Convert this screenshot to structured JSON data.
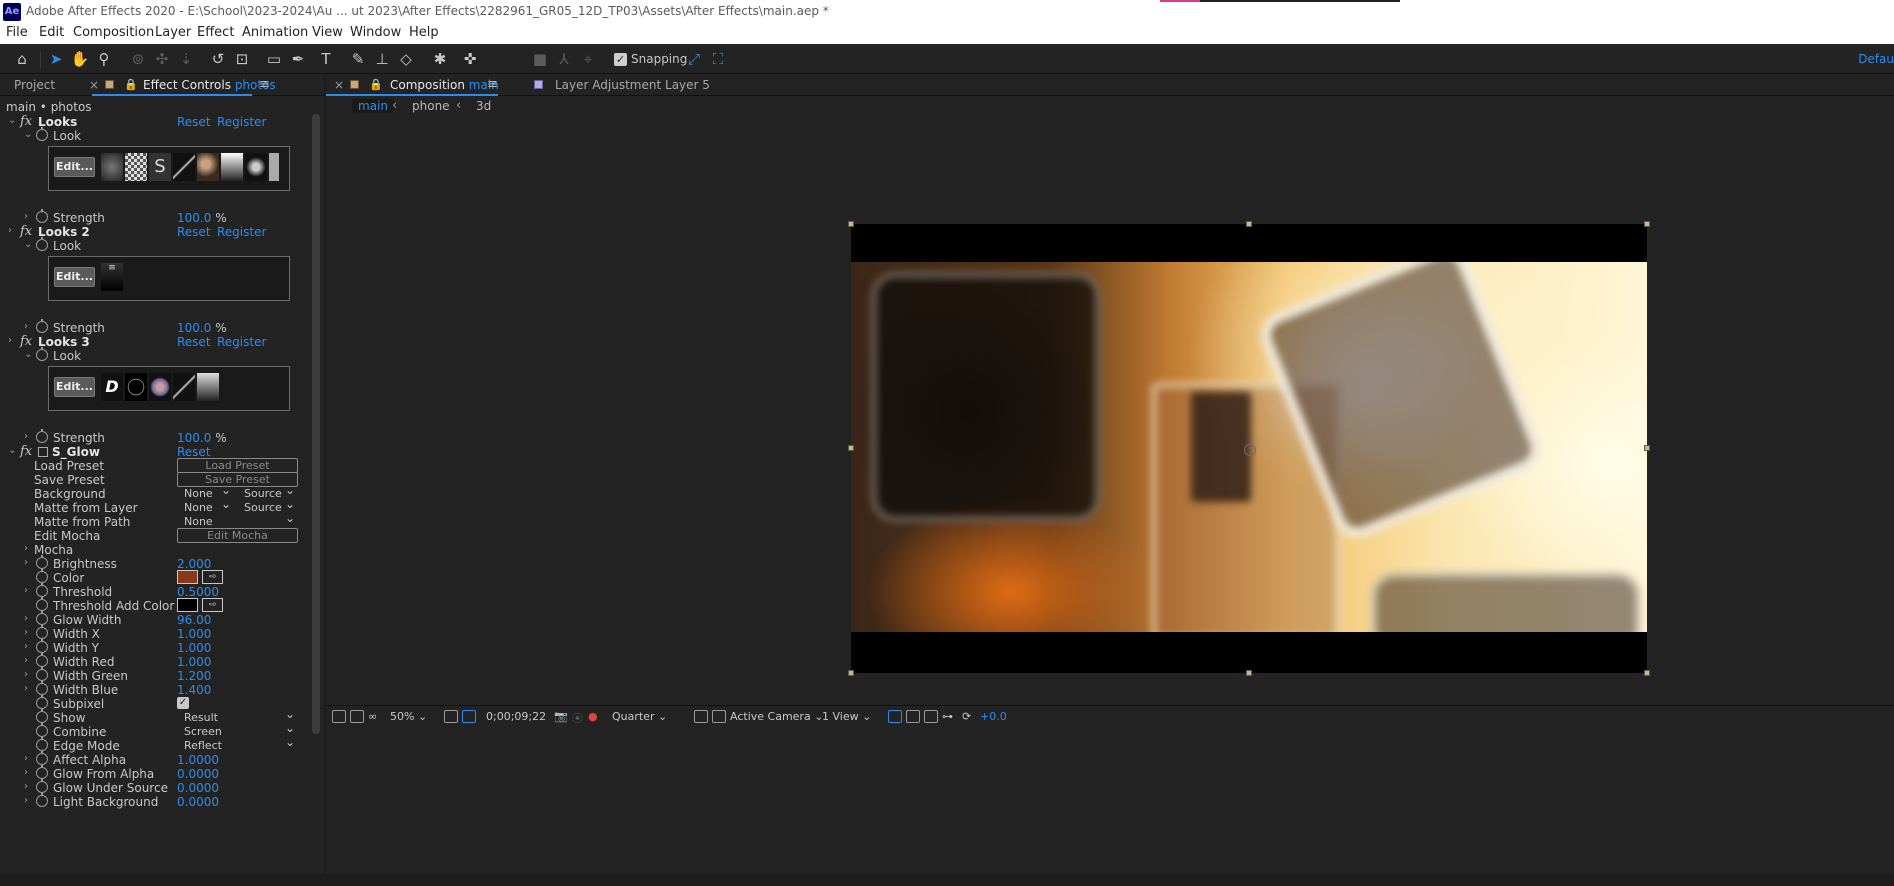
{
  "window": {
    "title": "Adobe After Effects 2020 - E:\\School\\2023-2024\\Au ... ut 2023\\After Effects\\2282961_GR05_12D_TP03\\Assets\\After Effects\\main.aep *",
    "app_badge": "Ae"
  },
  "menu": [
    "File",
    "Edit",
    "Composition",
    "Layer",
    "Effect",
    "Animation",
    "View",
    "Window",
    "Help"
  ],
  "toolbar": {
    "snapping_label": "Snapping",
    "snapping_checked": true,
    "workspace": "Defau"
  },
  "left_panel": {
    "tabs": {
      "project": "Project",
      "effect_controls_prefix": "Effect Controls",
      "effect_controls_layer": "photos"
    },
    "breadcrumb": "main • photos",
    "effects": {
      "looks1": {
        "name": "Looks",
        "reset": "Reset",
        "register": "Register",
        "look_label": "Look",
        "edit": "Edit...",
        "strength_label": "Strength",
        "strength_value": "100.0",
        "strength_unit": "%"
      },
      "looks2": {
        "name": "Looks 2",
        "reset": "Reset",
        "register": "Register",
        "look_label": "Look",
        "edit": "Edit...",
        "strength_label": "Strength",
        "strength_value": "100.0",
        "strength_unit": "%"
      },
      "looks3": {
        "name": "Looks 3",
        "reset": "Reset",
        "register": "Register",
        "look_label": "Look",
        "edit": "Edit...",
        "strength_label": "Strength",
        "strength_value": "100.0",
        "strength_unit": "%"
      },
      "sglow": {
        "name": "S_Glow",
        "reset": "Reset",
        "load_preset_label": "Load Preset",
        "load_preset_btn": "Load Preset",
        "save_preset_label": "Save Preset",
        "save_preset_btn": "Save Preset",
        "background_label": "Background",
        "background_a": "None",
        "background_b": "Source",
        "matte_layer_label": "Matte from Layer",
        "matte_layer_a": "None",
        "matte_layer_b": "Source",
        "matte_path_label": "Matte from Path",
        "matte_path_value": "None",
        "edit_mocha_label": "Edit Mocha",
        "edit_mocha_btn": "Edit Mocha",
        "mocha_label": "Mocha",
        "brightness_label": "Brightness",
        "brightness_value": "2.000",
        "color_label": "Color",
        "color_value": "#8a3a18",
        "threshold_label": "Threshold",
        "threshold_value": "0.5000",
        "threshold_add_color_label": "Threshold Add Color",
        "threshold_add_color_value": "#000000",
        "glow_width_label": "Glow Width",
        "glow_width_value": "96.00",
        "width_x_label": "Width X",
        "width_x_value": "1.000",
        "width_y_label": "Width Y",
        "width_y_value": "1.000",
        "width_red_label": "Width Red",
        "width_red_value": "1.000",
        "width_green_label": "Width Green",
        "width_green_value": "1.200",
        "width_blue_label": "Width Blue",
        "width_blue_value": "1.400",
        "subpixel_label": "Subpixel",
        "subpixel_checked": true,
        "show_label": "Show",
        "show_value": "Result",
        "combine_label": "Combine",
        "combine_value": "Screen",
        "edge_mode_label": "Edge Mode",
        "edge_mode_value": "Reflect",
        "affect_alpha_label": "Affect Alpha",
        "affect_alpha_value": "1.0000",
        "glow_from_alpha_label": "Glow From Alpha",
        "glow_from_alpha_value": "0.0000",
        "glow_under_source_label": "Glow Under Source",
        "glow_under_source_value": "0.0000",
        "light_background_label": "Light Background",
        "light_background_value": "0.0000"
      }
    }
  },
  "comp_panel": {
    "tab_comp_prefix": "Composition",
    "tab_comp_name": "main",
    "tab_layer_prefix": "Layer",
    "tab_layer_name": "Adjustment Layer 5",
    "subtabs": [
      "main",
      "phone",
      "3d"
    ],
    "bottom": {
      "zoom": "50%",
      "timecode": "0;00;09;22",
      "resolution": "Quarter",
      "camera": "Active Camera",
      "views": "1 View",
      "exposure": "+0.0"
    }
  }
}
